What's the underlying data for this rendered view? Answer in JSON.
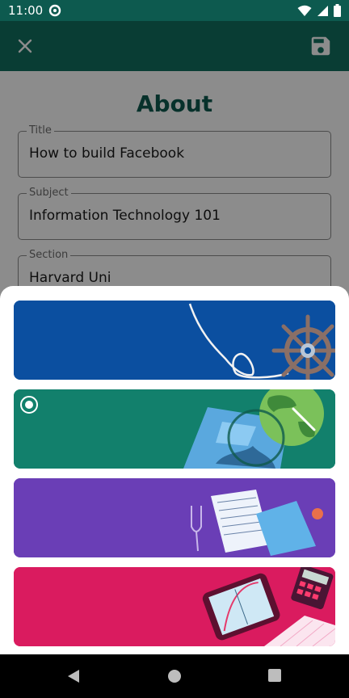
{
  "status_bar": {
    "time": "11:00",
    "left_icon": "data-saver-icon",
    "right_icons": [
      "wifi-icon",
      "cellular-signal-icon",
      "battery-icon"
    ]
  },
  "app_bar": {
    "close_icon": "close-icon",
    "save_icon": "save-icon",
    "background": "#11705f"
  },
  "sheet": {
    "title": "About",
    "title_color": "#0d5a4f",
    "fields": [
      {
        "label": "Title",
        "value": "How to build Facebook"
      },
      {
        "label": "Subject",
        "value": "Information Technology 101"
      },
      {
        "label": "Section",
        "value": "Harvard Uni"
      }
    ]
  },
  "theme_picker": {
    "themes": [
      {
        "name": "Sailing",
        "color": "#0b4fa0",
        "selected": false
      },
      {
        "name": "Globe",
        "color": "#12806c",
        "selected": true
      },
      {
        "name": "Music",
        "color": "#6a3eb6",
        "selected": false
      },
      {
        "name": "Math",
        "color": "#da1b5f",
        "selected": false
      }
    ]
  },
  "nav_bar": {
    "icons": [
      "back-icon",
      "home-icon",
      "recents-icon"
    ]
  }
}
